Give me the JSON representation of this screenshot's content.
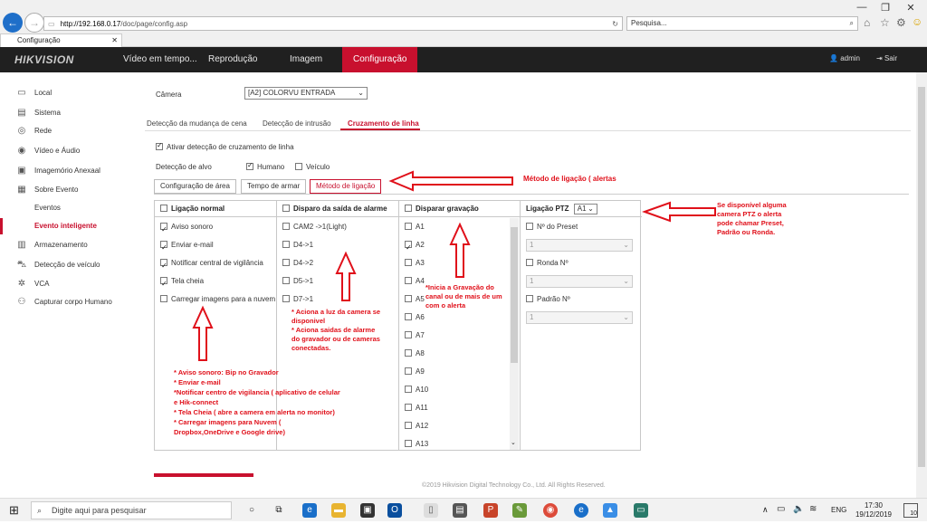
{
  "browser": {
    "url_host": "http://192.168.0.17",
    "url_path": "/doc/page/config.asp",
    "search_placeholder": "Pesquisa...",
    "tab_title": "Configuração"
  },
  "header": {
    "logo": "HIKVISION",
    "menu": [
      "Vídeo em tempo...",
      "Reprodução",
      "Imagem",
      "Configuração"
    ],
    "user": "admin",
    "logout": "Sair"
  },
  "sidebar": {
    "items": [
      "Local",
      "Sistema",
      "Rede",
      "Vídeo e Áudio",
      "Imagemório Anexaal",
      "Sobre Evento",
      "Eventos",
      "Evento inteligente",
      "Armazenamento",
      "Detecção de veículo",
      "VCA",
      "Capturar corpo Humano"
    ]
  },
  "main": {
    "camera_label": "Câmera",
    "camera_value": "[A2] COLORVU ENTRADA",
    "tabs": [
      "Detecção da mudança de cena",
      "Detecção de intrusão",
      "Cruzamento de linha"
    ],
    "enable_label": "Ativar detecção de cruzamento de linha",
    "target_label": "Detecção de alvo",
    "target_human": "Humano",
    "target_vehicle": "Veículo",
    "steps": [
      "Configuração de área",
      "Tempo de armar",
      "Método de ligação"
    ],
    "col1": {
      "header": "Ligação normal",
      "items": [
        {
          "label": "Aviso sonoro",
          "checked": true
        },
        {
          "label": "Enviar e-mail",
          "checked": true
        },
        {
          "label": "Notificar central de vigilância",
          "checked": true
        },
        {
          "label": "Tela cheia",
          "checked": true
        },
        {
          "label": "Carregar imagens para a nuvem",
          "checked": false
        }
      ]
    },
    "col2": {
      "header": "Disparo da saída de alarme",
      "items": [
        "CAM2 ->1(Light)",
        "D4->1",
        "D4->2",
        "D5->1",
        "D7->1"
      ]
    },
    "col3": {
      "header": "Disparar gravação",
      "items": [
        "A1",
        "A2",
        "A3",
        "A4",
        "A5",
        "A6",
        "A7",
        "A8",
        "A9",
        "A10",
        "A11",
        "A12",
        "A13"
      ],
      "checked_item": "A2"
    },
    "col4": {
      "header": "Ligação PTZ",
      "channel": "A1",
      "preset_label": "Nº do Preset",
      "patrol_label": "Ronda Nº",
      "pattern_label": "Padrão Nº",
      "select_value": "1"
    },
    "footer": "©2019 Hikvision Digital Technology Co., Ltd. All Rights Reserved."
  },
  "annotations": {
    "metodo": "Método de ligação ( alertas",
    "ptz": [
      "Se disponível alguma",
      "camera PTZ o alerta",
      "pode chamar Preset,",
      "Padrão ou Ronda."
    ],
    "gravacao": [
      "*Inicia a Gravação do",
      "canal ou de mais de um",
      "com o alerta"
    ],
    "saida": [
      "* Aciona a luz da camera se",
      "disponivel",
      "* Aciona saidas de alarme",
      "do gravador ou de cameras",
      "conectadas."
    ],
    "ligacao": [
      "* Aviso sonoro: Bip no Gravador",
      "* Enviar e-mail",
      "*Notificar centro de vigilancia ( aplicativo de celular",
      "e Hik-connect",
      "* Tela Cheia ( abre a camera em alerta no monitor)",
      "* Carregar imagens para Nuvem (",
      "Dropbox,OneDrive e Google drive)"
    ]
  },
  "taskbar": {
    "search_placeholder": "Digite aqui para pesquisar",
    "lang": "ENG",
    "time": "17:30",
    "date": "19/12/2019",
    "notif": "10"
  },
  "colors": {
    "accent": "#c8102e",
    "annotation": "#e0101a",
    "header": "#202020"
  }
}
